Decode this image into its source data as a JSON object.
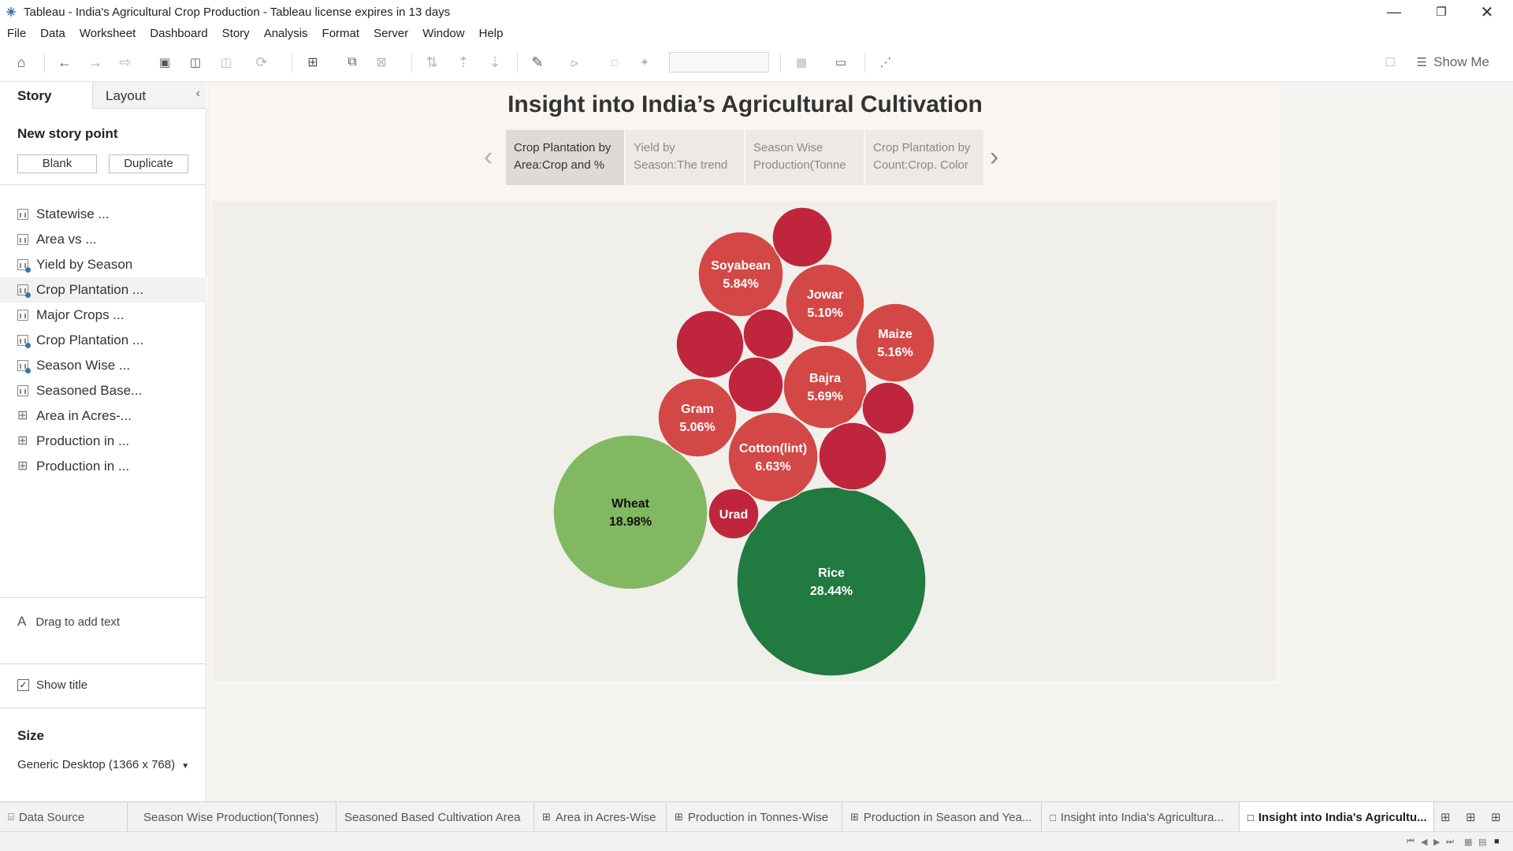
{
  "window": {
    "title": "Tableau - India's Agricultural Crop Production - Tableau license expires in 13 days"
  },
  "menu": [
    "File",
    "Data",
    "Worksheet",
    "Dashboard",
    "Story",
    "Analysis",
    "Format",
    "Server",
    "Window",
    "Help"
  ],
  "toolbar": {
    "show_me_label": "Show Me"
  },
  "left_pane": {
    "tabs": {
      "story": "Story",
      "layout": "Layout"
    },
    "new_story_point": "New story point",
    "blank_label": "Blank",
    "duplicate_label": "Duplicate",
    "sheets": [
      {
        "label": "Statewise ...",
        "type": "dashboard"
      },
      {
        "label": "Area vs ...",
        "type": "dashboard"
      },
      {
        "label": "Yield by Season",
        "type": "worksheet"
      },
      {
        "label": "Crop Plantation ...",
        "type": "worksheet"
      },
      {
        "label": "Major Crops ...",
        "type": "dashboard"
      },
      {
        "label": "Crop Plantation ...",
        "type": "worksheet"
      },
      {
        "label": "Season Wise ...",
        "type": "worksheet"
      },
      {
        "label": "Seasoned Base...",
        "type": "dashboard"
      },
      {
        "label": "Area in Acres-...",
        "type": "grid"
      },
      {
        "label": "Production in ...",
        "type": "grid"
      },
      {
        "label": "Production in ...",
        "type": "grid"
      }
    ],
    "drag_text": "Drag to add text",
    "show_title_label": "Show title",
    "show_title_checked": true,
    "size_title": "Size",
    "size_value": "Generic Desktop (1366 x 768)"
  },
  "story": {
    "title": "Insight into India’s Agricultural Cultivation",
    "points": [
      {
        "line1": "Crop Plantation by",
        "line2": "Area:Crop and %",
        "active": true
      },
      {
        "line1": "Yield by",
        "line2": "Season:The trend",
        "active": false
      },
      {
        "line1": "Season Wise",
        "line2": "Production(Tonne",
        "active": false
      },
      {
        "line1": "Crop Plantation by",
        "line2": "Count:Crop. Color",
        "active": false
      }
    ]
  },
  "chart_data": {
    "type": "bubble",
    "measure": "% of cultivated area",
    "bubbles": [
      {
        "label": "Rice",
        "value": 28.44,
        "value_label": "28.44%",
        "color": "#217a40"
      },
      {
        "label": "Wheat",
        "value": 18.98,
        "value_label": "18.98%",
        "color": "#82b862"
      },
      {
        "label": "Cotton(lint)",
        "value": 6.63,
        "value_label": "6.63%",
        "color": "#d34846"
      },
      {
        "label": "Soyabean",
        "value": 5.84,
        "value_label": "5.84%",
        "color": "#d34846"
      },
      {
        "label": "Bajra",
        "value": 5.69,
        "value_label": "5.69%",
        "color": "#d34846"
      },
      {
        "label": "Maize",
        "value": 5.16,
        "value_label": "5.16%",
        "color": "#d34846"
      },
      {
        "label": "Jowar",
        "value": 5.1,
        "value_label": "5.10%",
        "color": "#d34846"
      },
      {
        "label": "Gram",
        "value": 5.06,
        "value_label": "5.06%",
        "color": "#d34846"
      },
      {
        "label": "Urad",
        "value": null,
        "value_label": "",
        "color": "#c0253e"
      },
      {
        "label": "",
        "value": null,
        "value_label": "",
        "color": "#c0253e"
      },
      {
        "label": "",
        "value": null,
        "value_label": "",
        "color": "#c0253e"
      },
      {
        "label": "",
        "value": null,
        "value_label": "",
        "color": "#c0253e"
      },
      {
        "label": "",
        "value": null,
        "value_label": "",
        "color": "#c0253e"
      },
      {
        "label": "",
        "value": null,
        "value_label": "",
        "color": "#c0253e"
      },
      {
        "label": "",
        "value": null,
        "value_label": "",
        "color": "#c0253e"
      }
    ]
  },
  "bottom_tabs": [
    {
      "label": "Data Source",
      "icon": "database-icon",
      "active": false
    },
    {
      "label": "Season Wise Production(Tonnes)",
      "icon": "",
      "active": false
    },
    {
      "label": "Seasoned Based Cultivation Area",
      "icon": "",
      "active": false
    },
    {
      "label": "Area in Acres-Wise",
      "icon": "grid-icon",
      "active": false
    },
    {
      "label": "Production in Tonnes-Wise",
      "icon": "grid-icon",
      "active": false
    },
    {
      "label": "Production in Season and Yea...",
      "icon": "grid-icon",
      "active": false
    },
    {
      "label": "Insight into India's Agricultura...",
      "icon": "story-icon",
      "active": false
    },
    {
      "label": "Insight into India's Agricultu...",
      "icon": "story-icon",
      "active": true
    }
  ],
  "colors": {
    "accent_red": "#d34846",
    "deep_red": "#c0253e",
    "dark_green": "#217a40",
    "light_green": "#82b862"
  }
}
